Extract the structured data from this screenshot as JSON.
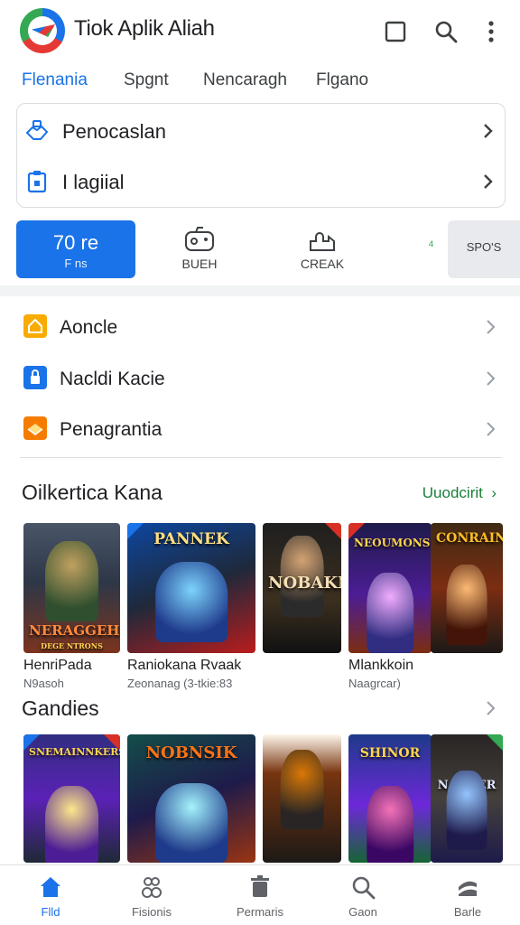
{
  "header": {
    "app_title": "Tiok Aplik Aliah",
    "icons": [
      "square-icon",
      "search-icon",
      "more-vert-icon"
    ]
  },
  "tabs": [
    {
      "label": "Flenania",
      "active": true
    },
    {
      "label": "Spgnt",
      "active": false
    },
    {
      "label": "Nencaragh",
      "active": false
    },
    {
      "label": "Flgano",
      "active": false
    }
  ],
  "top_card": {
    "rows": [
      {
        "icon": "handshake-icon",
        "label": "Penocaslan"
      },
      {
        "icon": "clipboard-icon",
        "label": "I lagiial"
      }
    ]
  },
  "chips": {
    "primary": {
      "big": "70 re",
      "small": "F ns"
    },
    "items": [
      {
        "icon": "game-controller-icon",
        "label": "BUEH"
      },
      {
        "icon": "puzzle-icon",
        "label": "CREAK"
      }
    ],
    "mid_glyph": "⁴",
    "gray_label": "SPO'S"
  },
  "list": [
    {
      "icon": "home-icon",
      "label": "Aoncle",
      "color": "#f9ab00"
    },
    {
      "icon": "lock-icon",
      "label": "Nacldi Kacie",
      "color": "#1a73e8"
    },
    {
      "icon": "gift-icon",
      "label": "Penagrantia",
      "color": "#f57c00"
    }
  ],
  "section_featured": {
    "title": "Oilkertica Kana",
    "more": "Uuodcirit",
    "covers": [
      {
        "caption": "NERAGGEH",
        "subcaption": "DEGE NTRONS"
      },
      {
        "caption": "PANNEK",
        "subcaption": ""
      },
      {
        "caption": "NOBAKN",
        "subcaption": ""
      },
      {
        "caption": "NEOUMONS",
        "subcaption": ""
      },
      {
        "caption": "CONRAIN",
        "subcaption": ""
      }
    ],
    "games": [
      {
        "name": "HenriPada",
        "sub": "N9asoh"
      },
      {
        "name": "Raniokana Rvaak",
        "sub": "Zeonanag (3-tkie:83"
      },
      {
        "name": "Mlankkoin",
        "sub": "Naagrcar)"
      }
    ]
  },
  "section_games": {
    "title": "Gandies",
    "covers": [
      {
        "caption": "SNEMAINNKERS"
      },
      {
        "caption": "NOBNSIK"
      },
      {
        "caption": ""
      },
      {
        "caption": "SHINOR"
      },
      {
        "caption": "NARKER"
      }
    ]
  },
  "bottom_nav": [
    {
      "icon": "home-icon",
      "label": "Flld",
      "active": true
    },
    {
      "icon": "groups-icon",
      "label": "Fisionis",
      "active": false
    },
    {
      "icon": "trash-icon",
      "label": "Permaris",
      "active": false
    },
    {
      "icon": "search-icon",
      "label": "Gaon",
      "active": false
    },
    {
      "icon": "profile-icon",
      "label": "Barle",
      "active": false
    }
  ],
  "colors": {
    "accent": "#1a73e8",
    "link_green": "#188038",
    "text": "#202124"
  }
}
